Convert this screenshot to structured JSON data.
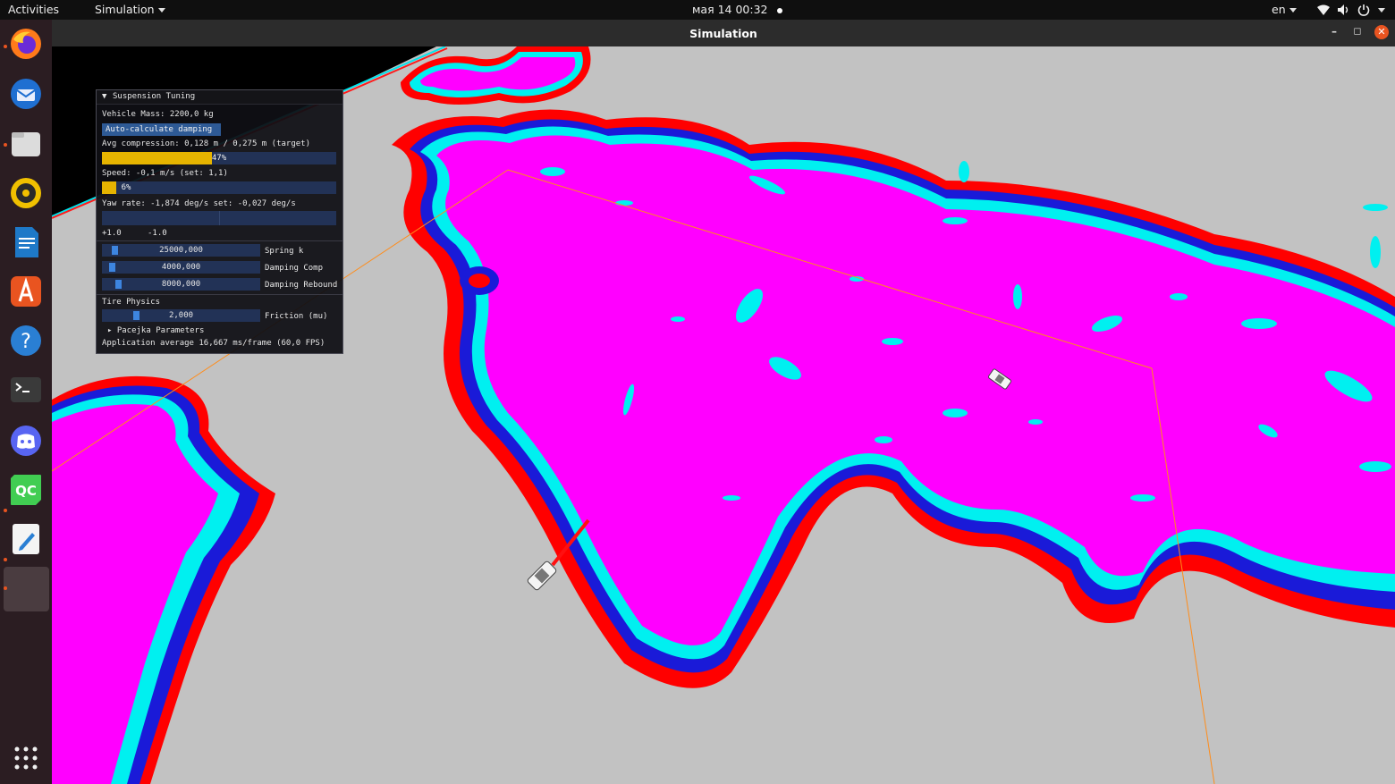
{
  "topbar": {
    "activities": "Activities",
    "app_menu": "Simulation",
    "clock": "мая 14  00:32",
    "lang": "en"
  },
  "dock": {
    "icons": [
      "firefox-icon",
      "thunderbird-icon",
      "files-icon",
      "rhythmbox-icon",
      "writer-icon",
      "app-center-icon",
      "help-icon",
      "terminal-icon",
      "discord-icon",
      "qtcreator-icon",
      "text-editor-icon",
      "simulation-app-icon",
      "show-apps-icon"
    ]
  },
  "window": {
    "title": "Simulation"
  },
  "panel": {
    "title": "Suspension Tuning",
    "vehicle_mass": "Vehicle Mass: 2200,0 kg",
    "auto_button": "Auto-calculate damping",
    "avg_compression": "Avg compression: 0,128 m / 0,275 m (target)",
    "compression_progress": 0.47,
    "compression_label": "47%",
    "speed": "Speed: -0,1 m/s (set: 1,1)",
    "speed_progress": 0.06,
    "speed_label": "6%",
    "yaw_rate": "Yaw rate: -1,874 deg/s set: -0,027 deg/s",
    "plot_max": "+1.0",
    "plot_min": "-1.0",
    "spring_value": "25000,000",
    "spring_label": "Spring k",
    "damping_comp_value": "4000,000",
    "damping_comp_label": "Damping Comp",
    "damping_rebound_value": "8000,000",
    "damping_rebound_label": "Damping Rebound",
    "tire_header": "Tire Physics",
    "friction_value": "2,000",
    "friction_label": "Friction (mu)",
    "pacejka": "Pacejka Parameters",
    "fps": "Application average 16,667 ms/frame (60,0 FPS)"
  }
}
